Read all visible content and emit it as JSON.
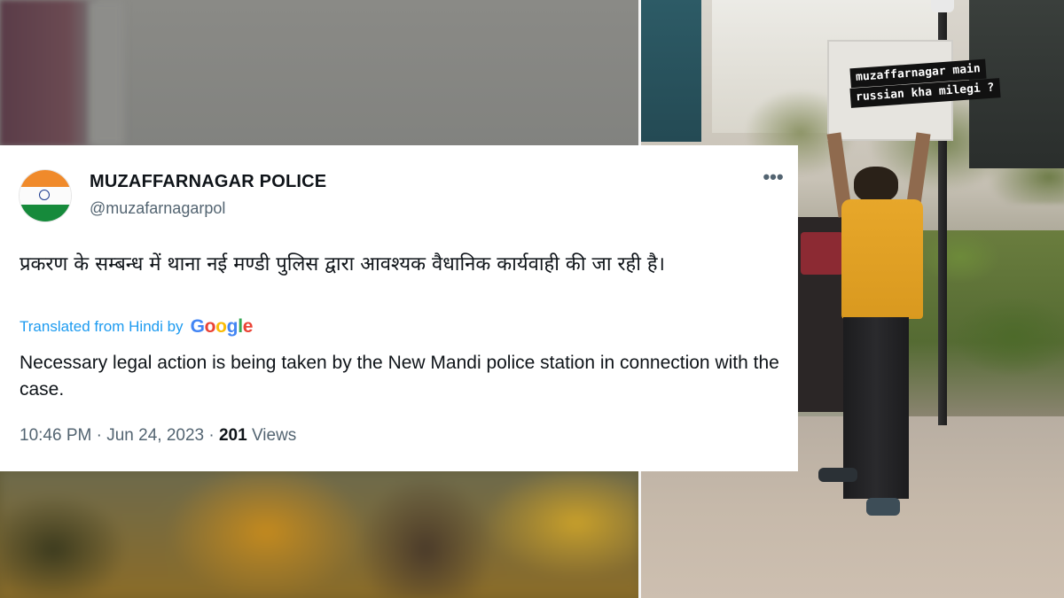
{
  "background": {
    "overlay_caption_line1": "muzaffarnagar main",
    "overlay_caption_line2": "russian kha milegi ?"
  },
  "tweet": {
    "display_name": "MUZAFFARNAGAR POLICE",
    "handle": "@muzafarnagarpol",
    "more_icon": "•••",
    "hindi_text": "प्रकरण के सम्बन्ध में थाना नई मण्डी पुलिस द्वारा आवश्यक वैधानिक कार्यवाही की जा रही है।",
    "translated_label": "Translated from Hindi by",
    "google_letters": [
      "G",
      "o",
      "o",
      "g",
      "l",
      "e"
    ],
    "english_text": "Necessary legal action is being taken by the New Mandi police station in connection with the case.",
    "time": "10:46 PM",
    "separator": "·",
    "date": "Jun 24, 2023",
    "views_count": "201",
    "views_label": "Views"
  },
  "colors": {
    "link_blue": "#1d9bf0",
    "text_primary": "#0f1419",
    "text_secondary": "#536471",
    "flag_saffron": "#f08a2b",
    "flag_green": "#168a3b"
  }
}
